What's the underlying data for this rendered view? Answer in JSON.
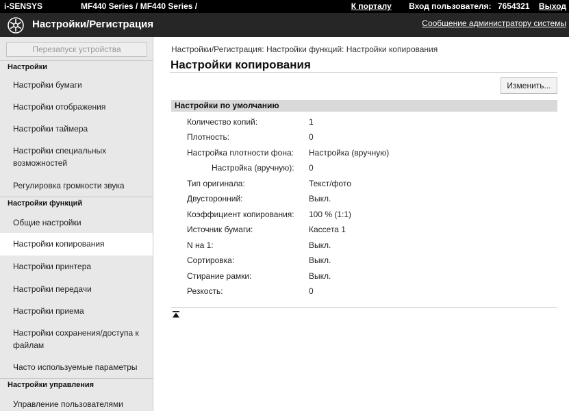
{
  "topbar": {
    "brand": "i-SENSYS",
    "model": "MF440 Series / MF440 Series /",
    "portal_link": "К порталу",
    "user_label": "Вход пользователя:",
    "user_id": "7654321",
    "logout": "Выход"
  },
  "header": {
    "icon": "gear-asterisk-icon",
    "title": "Настройки/Регистрация",
    "admin_message": "Сообщение администратору системы"
  },
  "sidebar": {
    "restart_button": "Перезапуск устройства",
    "sections": [
      {
        "title": "Настройки",
        "items": [
          "Настройки бумаги",
          "Настройки отображения",
          "Настройки таймера",
          "Настройки специальных возможностей",
          "Регулировка громкости звука"
        ]
      },
      {
        "title": "Настройки функций",
        "items": [
          "Общие настройки",
          "Настройки копирования",
          "Настройки принтера",
          "Настройки передачи",
          "Настройки приема",
          "Настройки сохранения/доступа к файлам",
          "Часто используемые параметры"
        ]
      },
      {
        "title": "Настройки управления",
        "items": [
          "Управление пользователями"
        ]
      }
    ],
    "active_item": "Настройки копирования"
  },
  "main": {
    "breadcrumb": "Настройки/Регистрация: Настройки функций: Настройки копирования",
    "title": "Настройки копирования",
    "edit_button": "Изменить...",
    "group_title": "Настройки по умолчанию",
    "settings": [
      {
        "label": "Количество копий:",
        "value": "1"
      },
      {
        "label": "Плотность:",
        "value": "0"
      },
      {
        "label": "Настройка плотности фона:",
        "value": "Настройка (вручную)"
      },
      {
        "label": "Настройка (вручную):",
        "value": "0"
      },
      {
        "label": "Тип оригинала:",
        "value": "Текст/фото"
      },
      {
        "label": "Двусторонний:",
        "value": "Выкл."
      },
      {
        "label": "Коэффициент копирования:",
        "value": "100 % (1:1)"
      },
      {
        "label": "Источник бумаги:",
        "value": "Кассета 1"
      },
      {
        "label": "N на 1:",
        "value": "Выкл."
      },
      {
        "label": "Сортировка:",
        "value": "Выкл."
      },
      {
        "label": "Стирание рамки:",
        "value": "Выкл."
      },
      {
        "label": "Резкость:",
        "value": "0"
      }
    ],
    "back_to_top_icon": "back-to-top-icon"
  }
}
